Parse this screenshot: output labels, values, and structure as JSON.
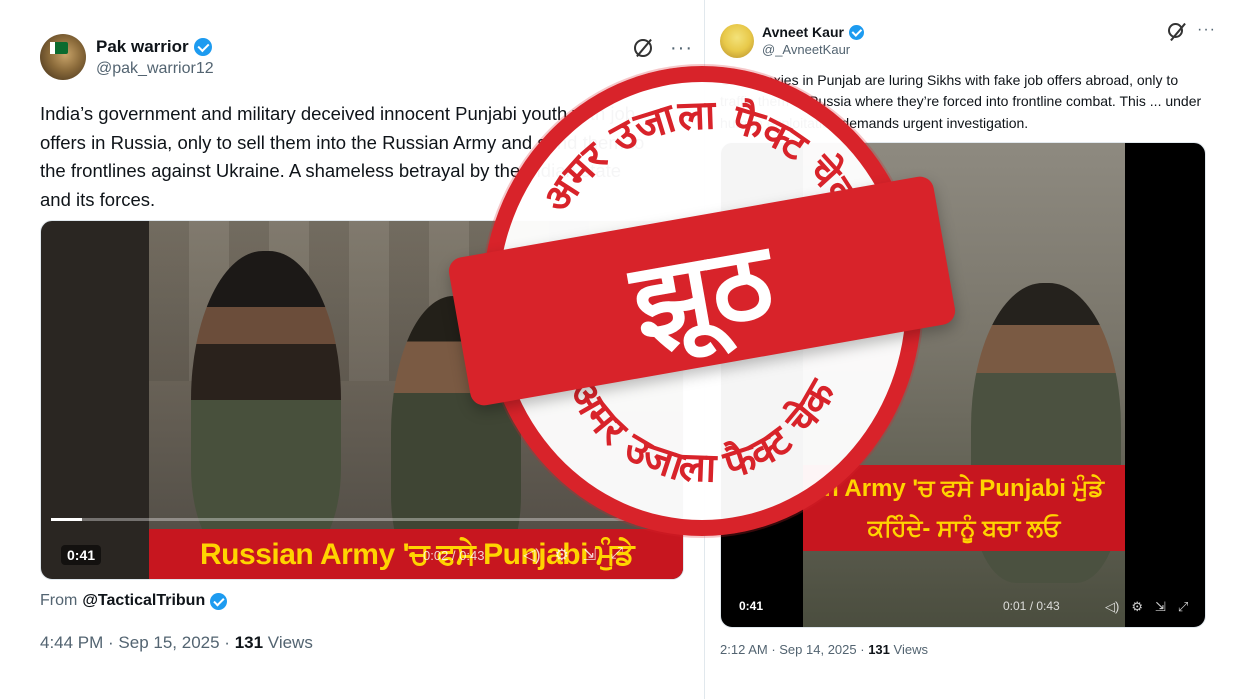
{
  "tweet_left": {
    "display_name": "Pak warrior",
    "handle": "@pak_warrior12",
    "text": "India’s government and military deceived innocent Punjabi youth with job offers in Russia, only to sell them into the Russian Army and send them to the frontlines against Ukraine. A shameless betrayal by the Indian state and its forces.",
    "video": {
      "caption": "Russian Army 'ਚ ਫਸੇ Punjabi ਮੁੰਡੇ",
      "duration": "0:41",
      "elapsed": "0:02 / 0:43",
      "progress": 0.05
    },
    "from_label": "From",
    "from_handle": "@TacticalTribun",
    "time": "4:44 PM",
    "date": "Sep 15, 2025",
    "views_count": "131",
    "views_label": "Views"
  },
  "tweet_right": {
    "display_name": "Avneet Kaur",
    "handle": "@_AvneetKaur",
    "text": "Govt proxies in Punjab are luring Sikhs with fake job offers abroad, only to traffic them to Russia where they’re forced into frontline combat. This ... under human exploitation demands urgent investigation.",
    "video": {
      "caption_line1": "n Army 'ਚ ਫਸੇ Punjabi ਮੁੰਡੇ",
      "caption_line2": "ਕਹਿੰਦੇ- ਸਾਨੂੰ ਬਚਾ ਲਓ",
      "duration": "0:41",
      "elapsed": "0:01 / 0:43"
    },
    "time": "2:12 AM",
    "date": "Sep 14, 2025",
    "views_count": "131",
    "views_label": "Views"
  },
  "stamp": {
    "verdict": "झूठ",
    "arc_text": "अमर उजाला फैक्ट चेक",
    "color": "#d8232a"
  },
  "colors": {
    "verified": "#1d9bf0",
    "muted_text": "#536471",
    "caption_bg": "#c7161f",
    "caption_text": "#ffd400"
  }
}
